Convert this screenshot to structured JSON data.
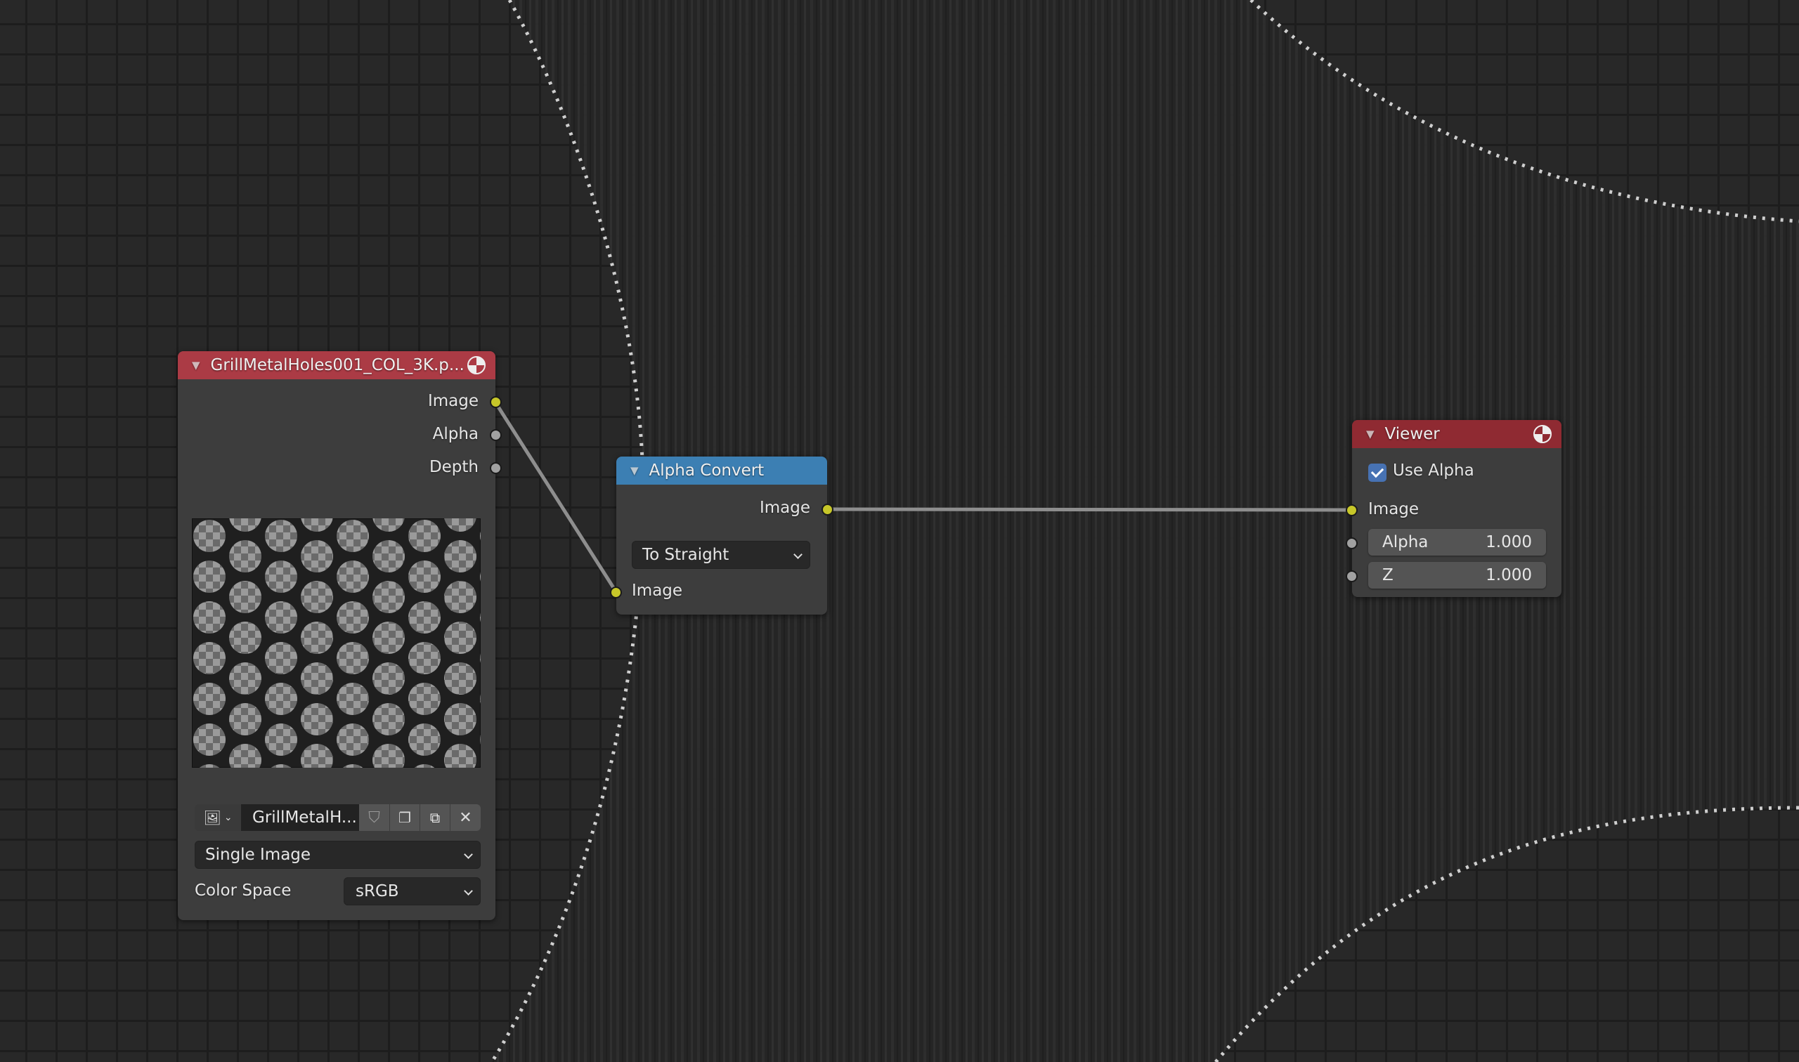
{
  "editor": "Compositor node editor",
  "colors": {
    "image_header": "#ab3b45",
    "converter_header": "#3c7fb3",
    "output_header": "#8f2a32",
    "socket_image": "#c7c729",
    "socket_value": "#a1a1a1",
    "link": "#9a9a9a",
    "checkbox": "#4772b3"
  },
  "nodes": {
    "image": {
      "title": "GrillMetalHoles001_COL_3K.p...",
      "outputs": [
        "Image",
        "Alpha",
        "Depth"
      ],
      "image_name": "GrillMetalH...",
      "icons": [
        "image-browse-icon",
        "fake-user-shield-icon",
        "duplicate-icon",
        "new-image-icon",
        "unlink-icon"
      ],
      "source": "Single Image",
      "color_space_label": "Color Space",
      "color_space": "sRGB"
    },
    "alpha_convert": {
      "title": "Alpha Convert",
      "output": "Image",
      "mode": "To Straight",
      "input": "Image"
    },
    "viewer": {
      "title": "Viewer",
      "use_alpha_label": "Use Alpha",
      "use_alpha": true,
      "input_image": "Image",
      "alpha_label": "Alpha",
      "alpha_value": "1.000",
      "z_label": "Z",
      "z_value": "1.000"
    }
  },
  "links": [
    {
      "from": "image.Image",
      "to": "alpha_convert.Image"
    },
    {
      "from": "alpha_convert.Image",
      "to": "viewer.Image"
    }
  ]
}
